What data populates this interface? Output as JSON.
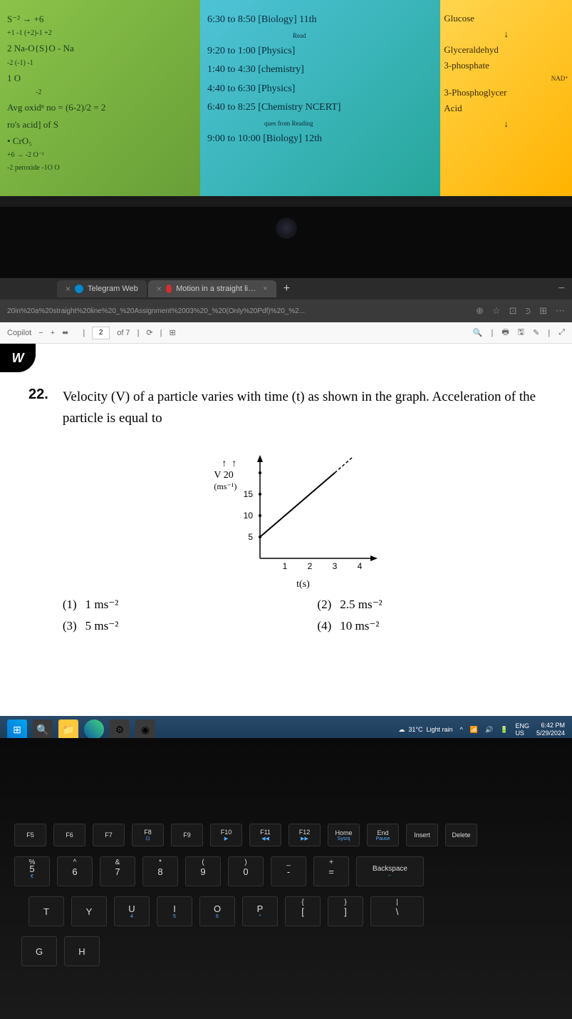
{
  "sticky_notes": {
    "green": {
      "line1": "S⁻² → +6",
      "line2": "+1  -1  (+2)-1  +2",
      "line3": "2 Na-O{S}O - Na",
      "line4": "-2  (-1)  -1",
      "line5": "1          O",
      "line6": "-2",
      "line7": "Avg oxidⁿ no = (6-2)/2 = 2",
      "line8": "ro's acid]   of S",
      "line9": "• CrO₅",
      "line10": "+6  →        -2  O⁻¹",
      "line11": "-2 peroxide  -1O  O"
    },
    "blue": {
      "line1": "6:30 to 8:50 [Biology] 11th",
      "line1_sub": "Read",
      "line2": "9:20 to 1:00 [Physics]",
      "line3": "1:40 to 4:30 [chemistry]",
      "line4": "4:40 to 6:30 [Physics]",
      "line5": "6:40 to 8:25 [Chemistry NCERT]",
      "line5_sub": "ques from Reading",
      "line6": "9:00 to 10:00 [Biology] 12th"
    },
    "yellow": {
      "line1": "Glucose",
      "line2": "↓",
      "line3": "Glyceraldehyd",
      "line4": "3-phosphate",
      "line4_sub": "NAD⁺",
      "line5": "3-Phosphoglycer",
      "line6": "Acid",
      "line7": "↓"
    }
  },
  "browser": {
    "tab1": "Telegram Web",
    "tab2": "Motion in a straight line _ Assignm",
    "url": "20in%20a%20straight%20line%20_%20Assignment%2003%20_%20(Only%20Pdf)%20_%2...",
    "copilot": "Copilot"
  },
  "pdf_toolbar": {
    "page_current": "2",
    "page_label": "of 7"
  },
  "document": {
    "logo": "W",
    "question_number": "22.",
    "question_text": "Velocity (V) of a particle varies with time (t) as shown in the graph. Acceleration of the particle is equal to",
    "y_axis_label": "V 20",
    "y_axis_unit": "(ms⁻¹)",
    "x_axis_label": "t(s)",
    "options": {
      "opt1_num": "(1)",
      "opt1_text": "1 ms⁻²",
      "opt2_num": "(2)",
      "opt2_text": "2.5 ms⁻²",
      "opt3_num": "(3)",
      "opt3_text": "5 ms⁻²",
      "opt4_num": "(4)",
      "opt4_text": "10 ms⁻²"
    }
  },
  "chart_data": {
    "type": "line",
    "title": "",
    "xlabel": "t(s)",
    "ylabel": "V (ms⁻¹)",
    "x_ticks": [
      1,
      2,
      3,
      4
    ],
    "y_ticks": [
      5,
      10,
      15,
      20
    ],
    "xlim": [
      0,
      4.5
    ],
    "ylim": [
      0,
      22
    ],
    "series": [
      {
        "name": "velocity",
        "x": [
          0,
          3
        ],
        "values": [
          5,
          20
        ],
        "style": "solid"
      },
      {
        "name": "velocity-extrapolated",
        "x": [
          3,
          3.7
        ],
        "values": [
          20,
          23.5
        ],
        "style": "dashed"
      }
    ]
  },
  "taskbar": {
    "weather_temp": "31°C",
    "weather_desc": "Light rain",
    "time": "6:42 PM",
    "date": "5/29/2024",
    "lang": "ENG",
    "region": "US"
  },
  "keyboard": {
    "row_fn": [
      "F5",
      "F6",
      "F7",
      "F8",
      "F9",
      "F10",
      "F11",
      "F12",
      "Home",
      "End",
      "Insert",
      "Delete"
    ],
    "row_num_top": [
      "%",
      "^",
      "&",
      "*",
      "(",
      ")",
      "_",
      "+"
    ],
    "row_num_main": [
      "5",
      "6",
      "7",
      "8",
      "9",
      "0",
      "-",
      "="
    ],
    "row_num_end": "Backspace",
    "row_qwerty": [
      "T",
      "Y",
      "U",
      "I",
      "O",
      "P",
      "{",
      "}",
      "|"
    ],
    "row_qwerty_sub": [
      "",
      "",
      "4",
      "5",
      "6",
      "*",
      "[",
      "]",
      "\\"
    ],
    "row_asdf": [
      "G",
      "H"
    ]
  }
}
